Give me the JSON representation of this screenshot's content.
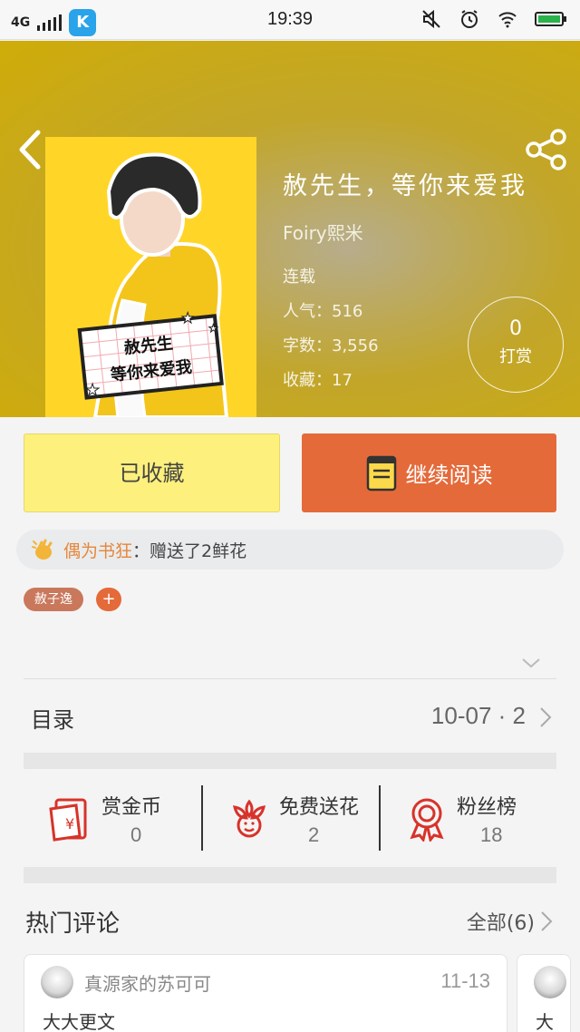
{
  "status_bar": {
    "network": "4G",
    "time": "19:39"
  },
  "book": {
    "title": "赦先生，等你来爱我",
    "author": "Foiry熙米",
    "cover_text_line1": "赦先生",
    "cover_text_line2": "等你来爱我",
    "status": "连载",
    "popularity_label": "人气：",
    "popularity": "516",
    "words_label": "字数：",
    "words": "3,556",
    "favorites_label": "收藏：",
    "favorites": "17"
  },
  "tip": {
    "count": "0",
    "label": "打赏"
  },
  "actions": {
    "collected_label": "已收藏",
    "continue_label": "继续阅读"
  },
  "gift_notice": {
    "user": "偶为书狂",
    "text": "：赠送了2鲜花"
  },
  "tags": [
    "赦子逸"
  ],
  "tag_add": "+",
  "catalog": {
    "label": "目录",
    "info": "10-07 · 2"
  },
  "stats": [
    {
      "label": "赏金币",
      "value": "0",
      "icon": "red-envelope-icon"
    },
    {
      "label": "免费送花",
      "value": "2",
      "icon": "flower-icon"
    },
    {
      "label": "粉丝榜",
      "value": "18",
      "icon": "medal-icon"
    }
  ],
  "comments": {
    "title": "热门评论",
    "all_label": "全部(6)",
    "items": [
      {
        "user": "真源家的苏可可",
        "date": "11-13",
        "text": "大大更文"
      },
      {
        "user": "",
        "date": "",
        "text": "大"
      }
    ]
  },
  "colors": {
    "accent": "#e56a3a",
    "collected_bg": "#fdf07c",
    "header_bg": "#cfac08"
  }
}
